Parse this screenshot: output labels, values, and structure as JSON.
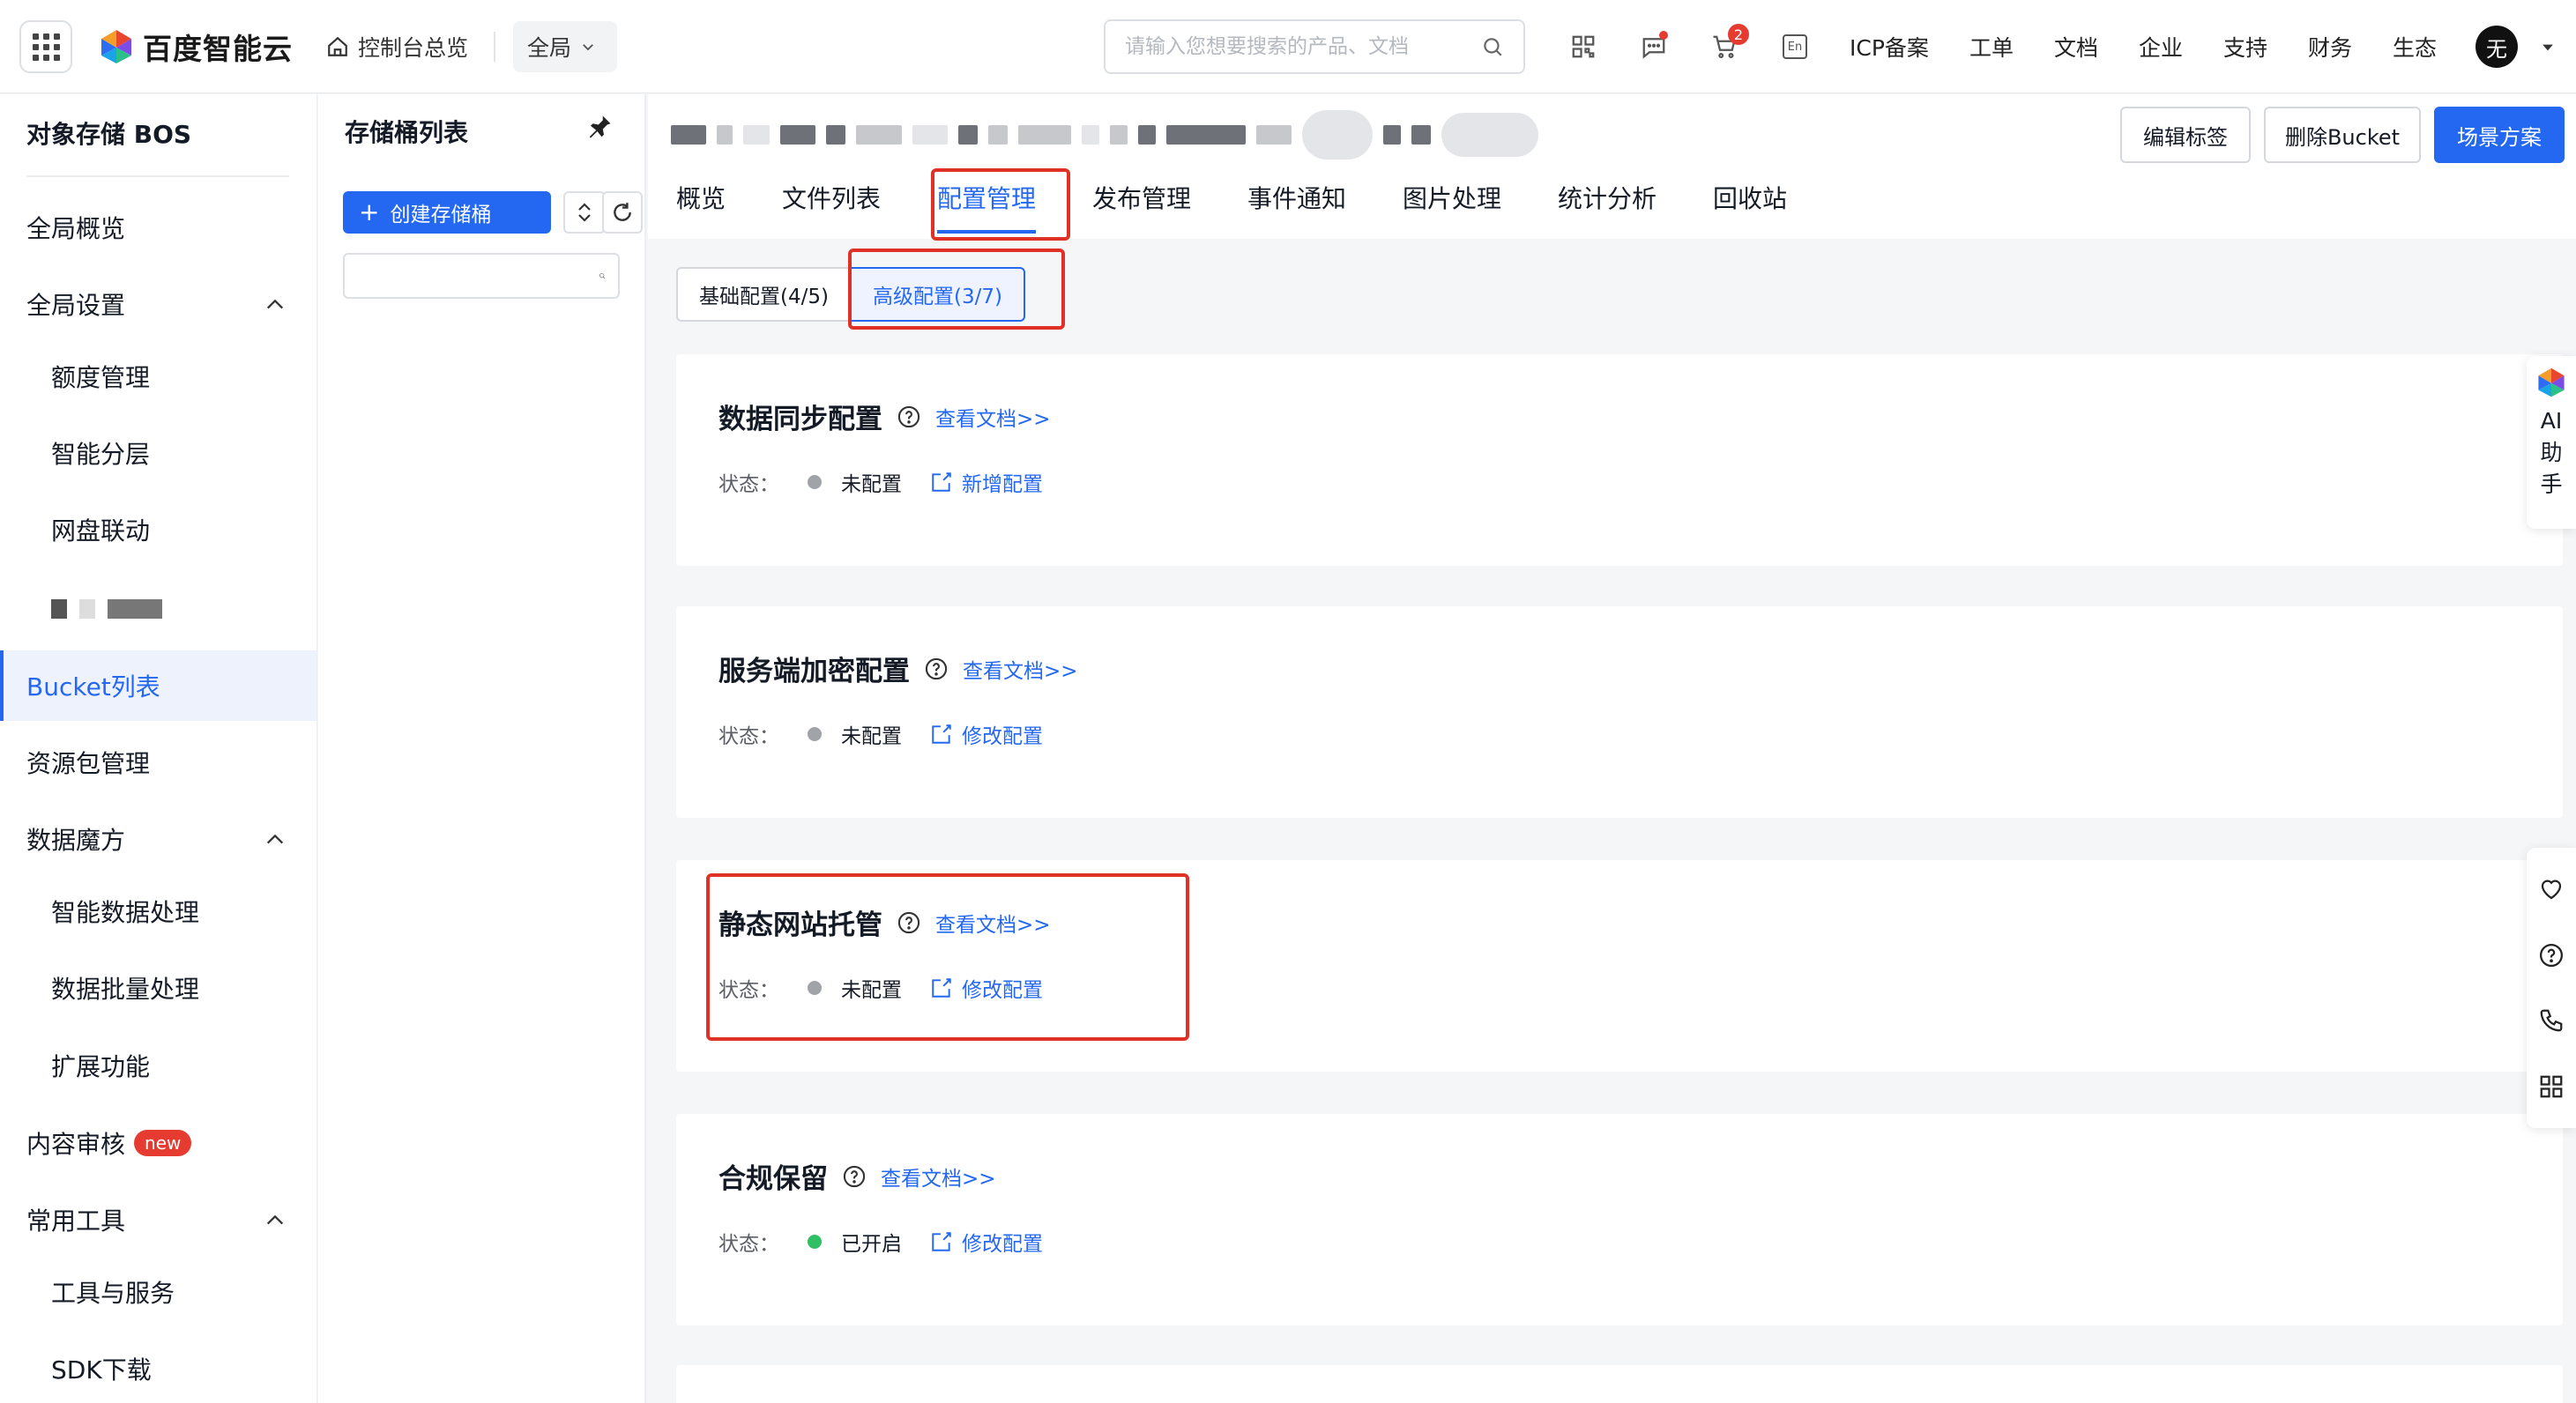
{
  "topbar": {
    "logo_text": "百度智能云",
    "home_label": "控制台总览",
    "region": "全局",
    "search_placeholder": "请输入您想要搜索的产品、文档",
    "cart_count": "2",
    "lang_icon_text": "En",
    "nav": [
      "ICP备案",
      "工单",
      "文档",
      "企业",
      "支持",
      "财务",
      "生态"
    ],
    "avatar_text": "无"
  },
  "sidebar": {
    "title": "对象存储 BOS",
    "items": [
      {
        "label": "全局概览"
      },
      {
        "label": "全局设置"
      },
      {
        "label": "额度管理"
      },
      {
        "label": "智能分层"
      },
      {
        "label": "网盘联动"
      },
      {
        "label": "Bucket列表"
      },
      {
        "label": "资源包管理"
      },
      {
        "label": "数据魔方"
      },
      {
        "label": "智能数据处理"
      },
      {
        "label": "数据批量处理"
      },
      {
        "label": "扩展功能"
      },
      {
        "label": "内容审核",
        "badge": "new"
      },
      {
        "label": "常用工具"
      },
      {
        "label": "工具与服务"
      },
      {
        "label": "SDK下载"
      }
    ]
  },
  "bucket_panel": {
    "title": "存储桶列表",
    "create_label": "创建存储桶",
    "search_value": ""
  },
  "main": {
    "buttons": {
      "edit_tags": "编辑标签",
      "delete_bucket": "删除Bucket",
      "scenario": "场景方案"
    },
    "tabs": [
      "概览",
      "文件列表",
      "配置管理",
      "发布管理",
      "事件通知",
      "图片处理",
      "统计分析",
      "回收站"
    ],
    "active_tab": "配置管理",
    "subtabs": [
      "基础配置(4/5)",
      "高级配置(3/7)"
    ],
    "active_subtab": "高级配置(3/7)",
    "status_label": "状态：",
    "cards": [
      {
        "title": "数据同步配置",
        "doc": "查看文档>>",
        "status": "未配置",
        "status_color": "#a0a3a8",
        "action": "新增配置"
      },
      {
        "title": "服务端加密配置",
        "doc": "查看文档>>",
        "status": "未配置",
        "status_color": "#a0a3a8",
        "action": "修改配置"
      },
      {
        "title": "静态网站托管",
        "doc": "查看文档>>",
        "status": "未配置",
        "status_color": "#a0a3a8",
        "action": "修改配置"
      },
      {
        "title": "合规保留",
        "doc": "查看文档>>",
        "status": "已开启",
        "status_color": "#30bf62",
        "action": "修改配置"
      }
    ]
  },
  "float": {
    "ai_label": "AI助手"
  },
  "colors": {
    "accent": "#2468f2",
    "danger": "#e63b30",
    "annotation": "#e03127"
  }
}
